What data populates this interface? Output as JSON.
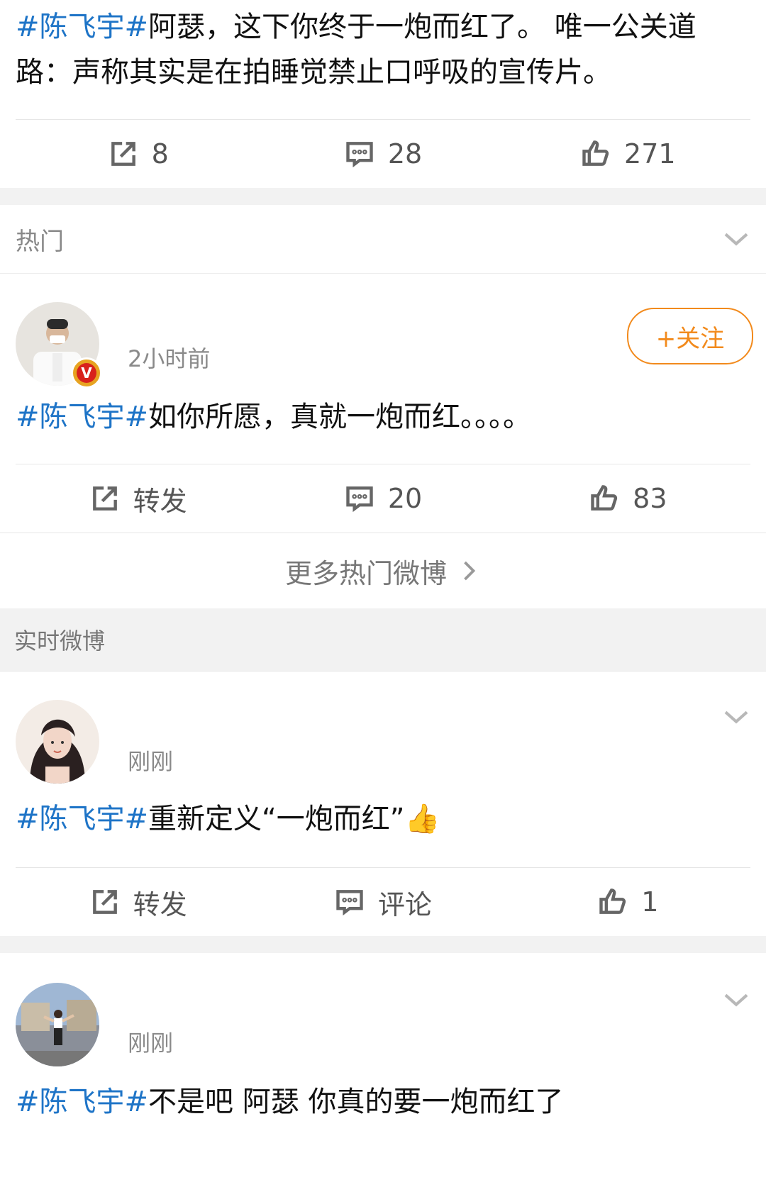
{
  "top_post": {
    "tag": "#陈飞宇#",
    "text": "阿瑟，这下你终于一炮而红了。 唯一公关道路：声称其实是在拍睡觉禁止口呼吸的宣传片。",
    "repost": "8",
    "comment": "28",
    "like": "271"
  },
  "hot_section": {
    "title": "热门",
    "post": {
      "time": "2小时前",
      "follow_label": "+关注",
      "badge": "V",
      "tag": "#陈飞宇#",
      "text": "如你所愿，真就一炮而红。。。。",
      "repost": "转发",
      "comment": "20",
      "like": "83"
    },
    "more_label": "更多热门微博"
  },
  "realtime_section": {
    "title": "实时微博",
    "posts": [
      {
        "time": "刚刚",
        "tag": "#陈飞宇#",
        "text": "重新定义“一炮而红”👍",
        "repost": "转发",
        "comment": "评论",
        "like": "1"
      },
      {
        "time": "刚刚",
        "tag": "#陈飞宇#",
        "text": "不是吧 阿瑟 你真的要一炮而红了"
      }
    ]
  },
  "colors": {
    "link_blue": "#1e74c7",
    "follow_orange": "#f28a1c",
    "divider_gray": "#f2f2f2"
  },
  "icons": [
    "repost-icon",
    "comment-icon",
    "like-icon",
    "chevron-down-icon",
    "chevron-right-icon"
  ]
}
